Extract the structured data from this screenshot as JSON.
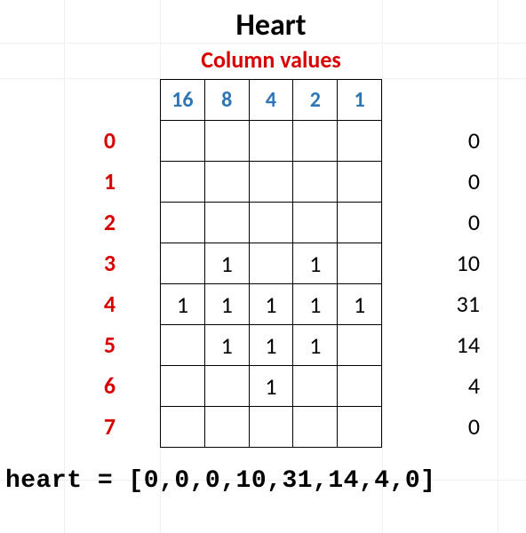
{
  "title": "Heart",
  "subtitle": "Column values",
  "column_headers": [
    "16",
    "8",
    "4",
    "2",
    "1"
  ],
  "rows": [
    {
      "label": "0",
      "cells": [
        "",
        "",
        "",
        "",
        ""
      ],
      "sum": "0"
    },
    {
      "label": "1",
      "cells": [
        "",
        "",
        "",
        "",
        ""
      ],
      "sum": "0"
    },
    {
      "label": "2",
      "cells": [
        "",
        "",
        "",
        "",
        ""
      ],
      "sum": "0"
    },
    {
      "label": "3",
      "cells": [
        "",
        "1",
        "",
        "1",
        ""
      ],
      "sum": "10"
    },
    {
      "label": "4",
      "cells": [
        "1",
        "1",
        "1",
        "1",
        "1"
      ],
      "sum": "31"
    },
    {
      "label": "5",
      "cells": [
        "",
        "1",
        "1",
        "1",
        ""
      ],
      "sum": "14"
    },
    {
      "label": "6",
      "cells": [
        "",
        "",
        "1",
        "",
        ""
      ],
      "sum": "4"
    },
    {
      "label": "7",
      "cells": [
        "",
        "",
        "",
        "",
        ""
      ],
      "sum": "0"
    }
  ],
  "code": "heart = [0,0,0,10,31,14,4,0]",
  "chart_data": {
    "type": "table",
    "title": "Heart",
    "columns": [
      16,
      8,
      4,
      2,
      1
    ],
    "matrix": [
      [
        0,
        0,
        0,
        0,
        0
      ],
      [
        0,
        0,
        0,
        0,
        0
      ],
      [
        0,
        0,
        0,
        0,
        0
      ],
      [
        0,
        1,
        0,
        1,
        0
      ],
      [
        1,
        1,
        1,
        1,
        1
      ],
      [
        0,
        1,
        1,
        1,
        0
      ],
      [
        0,
        0,
        1,
        0,
        0
      ],
      [
        0,
        0,
        0,
        0,
        0
      ]
    ],
    "row_values": [
      0,
      0,
      0,
      10,
      31,
      14,
      4,
      0
    ],
    "result_array_name": "heart"
  }
}
